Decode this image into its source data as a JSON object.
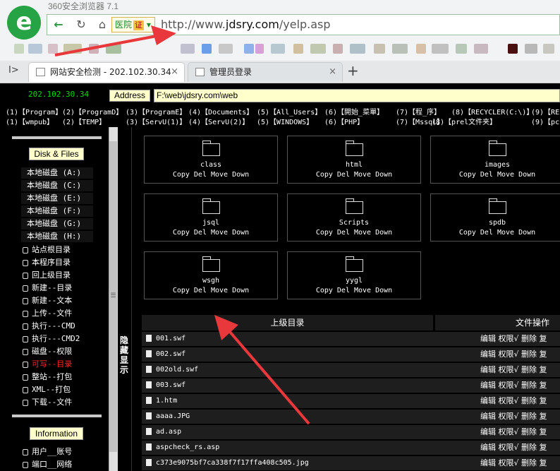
{
  "browser": {
    "title": "360安全浏览器 7.1",
    "badge_text": "医院",
    "badge_cert": "证",
    "url_prefix": "http://www.",
    "url_domain": "jdsry.com",
    "url_path": "/yelp.asp",
    "tabs": [
      {
        "label": "网站安全检测 - 202.102.30.34",
        "close": "×"
      },
      {
        "label": "管理员登录",
        "close": "×"
      }
    ],
    "new_tab": "+",
    "sidebar_toggle": "I>"
  },
  "page": {
    "ip": "202.102.30.34",
    "address_label": "Address",
    "address_value": "F:\\web\\jdsry.com\\web",
    "quick_row1": [
      "(1)【Program】",
      "(2)【ProgramD】",
      "(3)【ProgramE】",
      "(4)【Documents】",
      "(5)【All_Users】",
      "(6)【開始_菜單】",
      "(7)【程_序】",
      "(8)【RECYCLER(C:\\)】",
      "(9)【RE"
    ],
    "quick_row2": [
      "(1)【wmpub】",
      "(2)【TEMP】",
      "(3)【ServU(1)】",
      "(4)【ServU(2)】",
      "(5)【WINDOWS】",
      "(6)【PHP】",
      "(7)【Mssql】",
      "(8)【prel文件夹】",
      "(9)【pc"
    ],
    "left_panel": {
      "disk_header": "Disk & Files",
      "drives": [
        "本地磁盘 (A:)",
        "本地磁盘 (C:)",
        "本地磁盘 (E:)",
        "本地磁盘 (F:)",
        "本地磁盘 (G:)",
        "本地磁盘 (H:)"
      ],
      "links": [
        "站点根目录",
        "本程序目录",
        "回上级目录",
        "新建--目录",
        "新建--文本",
        "上传--文件",
        "执行---CMD",
        "执行---CMD2",
        "磁盘--权限",
        "可写--目录",
        "整站--打包",
        "XML--打包",
        "下载--文件"
      ],
      "info_header": "Information",
      "info_links": [
        "用户__账号",
        "端口__网络"
      ]
    },
    "hide_show": "隐藏显示",
    "folders": [
      {
        "name": "class",
        "ops": "Copy Del Move Down"
      },
      {
        "name": "html",
        "ops": "Copy Del Move Down"
      },
      {
        "name": "images",
        "ops": "Copy Del Move Down"
      },
      {
        "name": "jsql",
        "ops": "Copy Del Move Down"
      },
      {
        "name": "Scripts",
        "ops": "Copy Del Move Down"
      },
      {
        "name": "spdb",
        "ops": "Copy Del Move Down"
      },
      {
        "name": "wsgh",
        "ops": "Copy Del Move Down"
      },
      {
        "name": "yygl",
        "ops": "Copy Del Move Down"
      }
    ],
    "table": {
      "col_parent": "上级目录",
      "col_ops": "文件操作",
      "file_ops": "编辑 权限√ 删除 复",
      "files": [
        "001.swf",
        "002.swf",
        "002old.swf",
        "003.swf",
        "1.htm",
        "aaaa.JPG",
        "ad.asp",
        "aspcheck_rs.asp",
        "c373e9075bf7ca338f7f17ffa408c505.jpg"
      ]
    }
  },
  "colors": {
    "ip_green": "#00dd00",
    "accent_yellow": "#ffffcc",
    "arrow_red": "#e8383c",
    "warn_red": "#ff2222"
  }
}
